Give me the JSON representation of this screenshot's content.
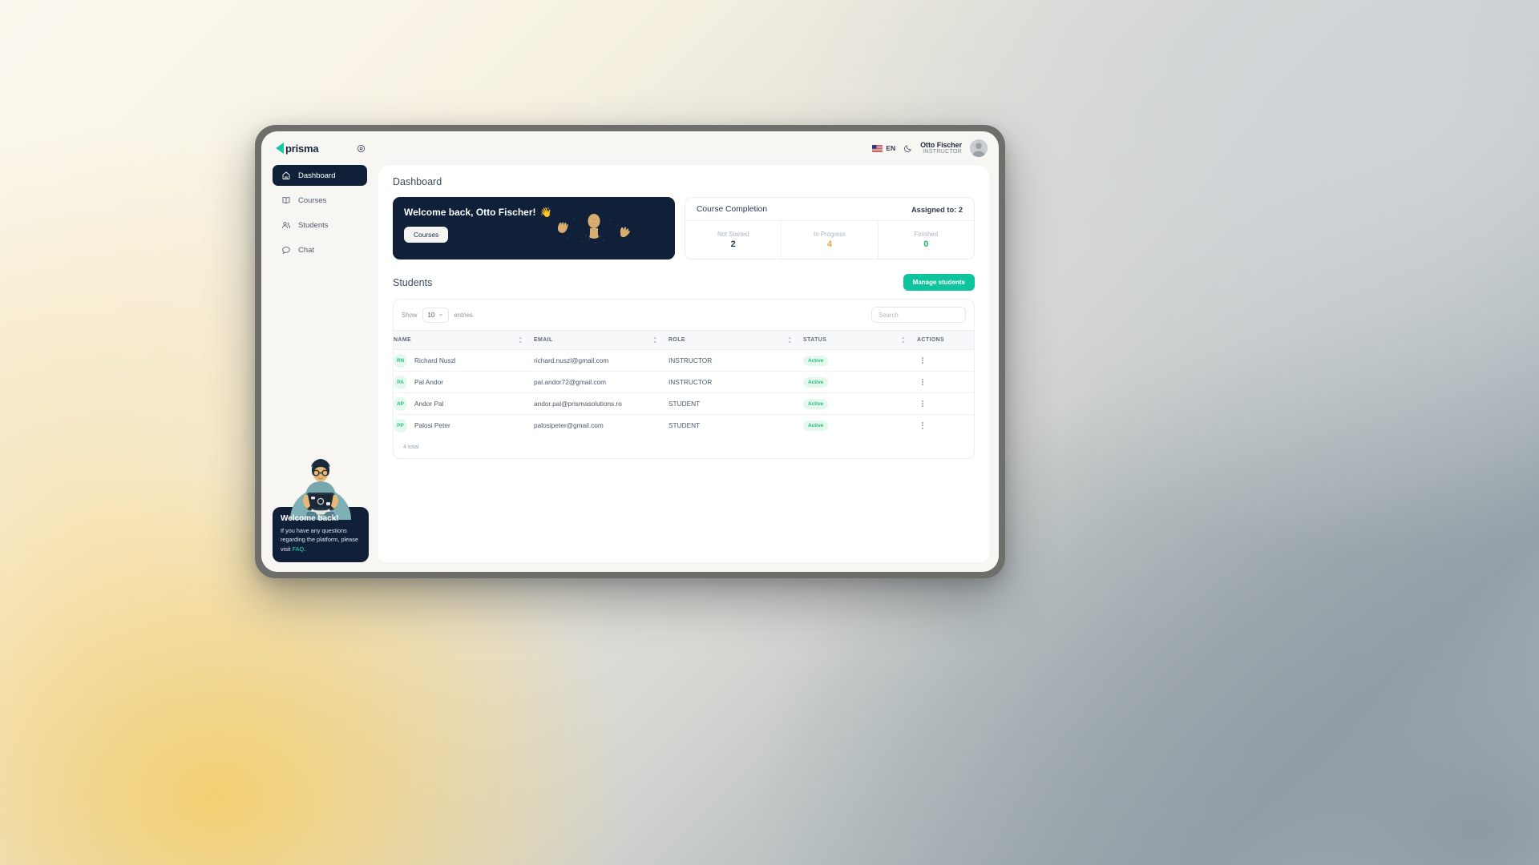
{
  "brand": {
    "name": "prisma",
    "accent": "#16c8a3",
    "dark": "#0f2038"
  },
  "topbar": {
    "collapse_icon": "target-circle-icon",
    "language": {
      "code": "EN",
      "flag": "us-flag-icon"
    },
    "theme_toggle_icon": "moon-icon",
    "user": {
      "name": "Otto Fischer",
      "role": "INSTRUCTOR",
      "avatar": "user-avatar"
    }
  },
  "sidebar": {
    "items": [
      {
        "label": "Dashboard",
        "icon": "home-icon",
        "active": true
      },
      {
        "label": "Courses",
        "icon": "book-icon",
        "active": false
      },
      {
        "label": "Students",
        "icon": "users-icon",
        "active": false
      },
      {
        "label": "Chat",
        "icon": "chat-bubble-icon",
        "active": false
      }
    ],
    "promo": {
      "illustration": "person-with-laptop-illustration",
      "title": "Welcome back!",
      "text_before": "If you have any questions regarding the platform, please visit ",
      "link": "FAQ",
      "text_after": "."
    }
  },
  "page": {
    "title": "Dashboard"
  },
  "banner": {
    "greeting": "Welcome back, Otto Fischer!",
    "wave_emoji": "👋",
    "button": "Courses",
    "art": "hands-and-face-emoji-art"
  },
  "course_completion": {
    "title": "Course Completion",
    "assigned_label": "Assigned to: 2",
    "stats": [
      {
        "label": "Not Started",
        "value": "2",
        "color": "#2b3a51"
      },
      {
        "label": "In Progress",
        "value": "4",
        "color": "#e9a43a"
      },
      {
        "label": "Finished",
        "value": "0",
        "color": "#1fb865"
      }
    ]
  },
  "students": {
    "section_title": "Students",
    "manage_button": "Manage students",
    "show_label": "Show",
    "entries_label": "entries",
    "entries_value": "10",
    "search_placeholder": "Search",
    "columns": [
      "NAME",
      "EMAIL",
      "ROLE",
      "STATUS",
      "ACTIONS"
    ],
    "rows": [
      {
        "initials": "RN",
        "name": "Richard Nuszl",
        "email": "richard.nuszl@gmail.com",
        "role": "INSTRUCTOR",
        "status": "Active"
      },
      {
        "initials": "PA",
        "name": "Pal Andor",
        "email": "pal.andor72@gmail.com",
        "role": "INSTRUCTOR",
        "status": "Active"
      },
      {
        "initials": "AP",
        "name": "Andor Pal",
        "email": "andor.pal@prismasolutions.ro",
        "role": "STUDENT",
        "status": "Active"
      },
      {
        "initials": "PP",
        "name": "Palosi Peter",
        "email": "palosipeter@gmail.com",
        "role": "STUDENT",
        "status": "Active"
      }
    ],
    "total_label": "4 total"
  }
}
